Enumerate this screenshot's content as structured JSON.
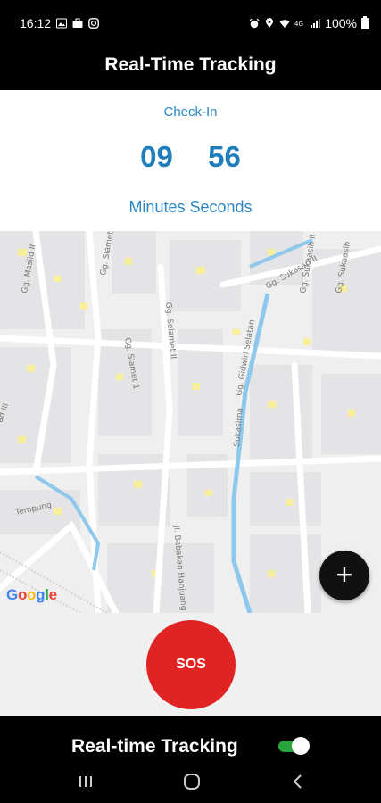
{
  "status_bar": {
    "time": "16:12",
    "battery": "100%",
    "icons_left": [
      "gallery-icon",
      "briefcase-icon",
      "instagram-icon"
    ],
    "icons_right": [
      "alarm-icon",
      "location-icon",
      "wifi-icon",
      "volte-icon",
      "signal-icon",
      "battery-icon"
    ]
  },
  "app_bar": {
    "title": "Real-Time Tracking"
  },
  "timer": {
    "label": "Check-In",
    "minutes": "09",
    "seconds": "56",
    "minutes_label": "Minutes",
    "seconds_label": "Seconds"
  },
  "map": {
    "attribution": "Google",
    "street_labels": [
      "Gg. Masjid II",
      "Gg. Slamet",
      "Gg. Slamet 1",
      "Gg. Selamet II",
      "Gg. Sukasari II",
      "Gg. Sukaasih",
      "Gg. Sukaasih II",
      "Gg. Gidwiri Selatan",
      "Sukasirna",
      "Jl. Babakan Hanjuang",
      "Tempung",
      "ad III"
    ]
  },
  "fab": {
    "label": "+"
  },
  "sos": {
    "label": "SOS",
    "color": "#e02424"
  },
  "bottom_bar": {
    "tracking_label": "Real-time Tracking",
    "tracking_enabled": true,
    "toggle_color": "#2aa43c"
  },
  "nav_bar": {
    "buttons": [
      "recents-icon",
      "home-icon",
      "back-icon"
    ]
  }
}
